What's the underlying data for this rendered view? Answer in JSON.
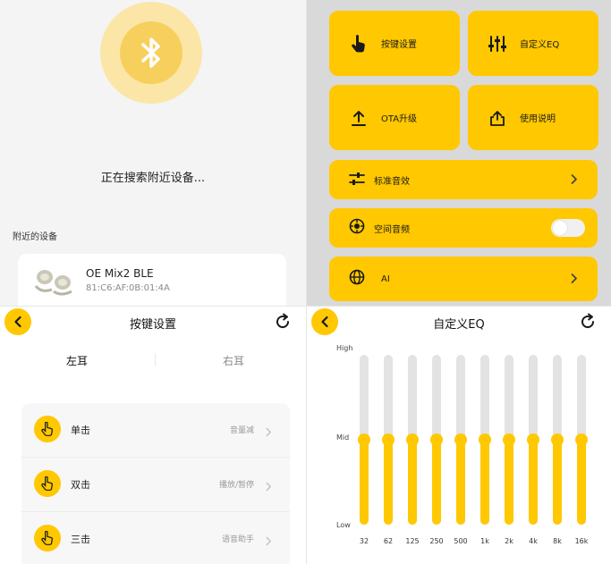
{
  "scan": {
    "searching_text": "正在搜索附近设备...",
    "nearby_label": "附近的设备",
    "device": {
      "name": "OE Mix2 BLE",
      "mac": "81:C6:AF:0B:01:4A"
    }
  },
  "menu": {
    "tiles": [
      {
        "label": "按键设置",
        "icon": "hand-pointer-icon"
      },
      {
        "label": "自定义EQ",
        "icon": "sliders-icon"
      },
      {
        "label": "OTA升级",
        "icon": "upload-icon"
      },
      {
        "label": "使用说明",
        "icon": "share-icon"
      }
    ],
    "rows": [
      {
        "label": "标准音效",
        "icon": "tune-icon",
        "trailing": "chevron"
      },
      {
        "label": "空间音频",
        "icon": "spatial-audio-icon",
        "trailing": "toggle",
        "toggle_on": false
      },
      {
        "label": "AI",
        "icon": "globe-icon",
        "trailing": "chevron"
      }
    ]
  },
  "keys": {
    "title": "按键设置",
    "tabs": [
      "左耳",
      "右耳"
    ],
    "active_tab": "左耳",
    "rows": [
      {
        "name": "单击",
        "value": "音量减"
      },
      {
        "name": "双击",
        "value": "播放/暂停"
      },
      {
        "name": "三击",
        "value": "语音助手"
      }
    ]
  },
  "eq": {
    "title": "自定义EQ",
    "levels": {
      "high": "High",
      "mid": "Mid",
      "low": "Low"
    },
    "bands": [
      "32",
      "62",
      "125",
      "250",
      "500",
      "1k",
      "2k",
      "4k",
      "8k",
      "16k"
    ],
    "gains_fraction": [
      0.5,
      0.5,
      0.5,
      0.5,
      0.5,
      0.5,
      0.5,
      0.5,
      0.5,
      0.5
    ]
  },
  "colors": {
    "accent": "#ffc800",
    "accent_light": "#fbe6a8",
    "track": "#e3e3e3"
  }
}
